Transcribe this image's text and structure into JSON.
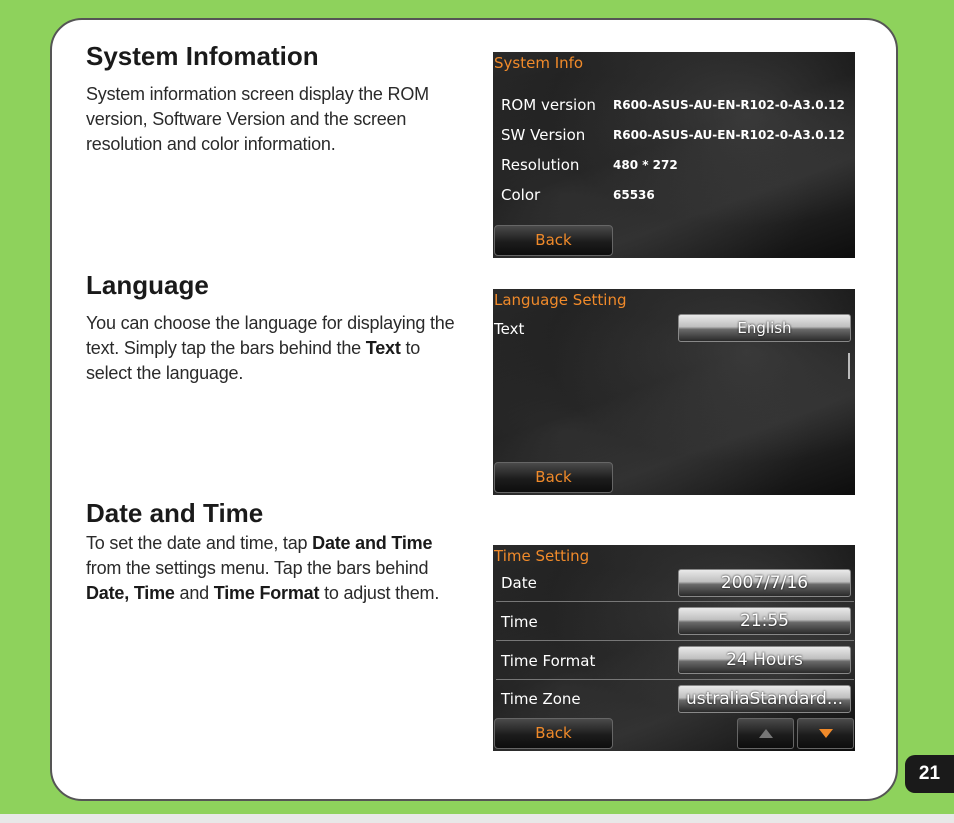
{
  "sections": {
    "system_info": {
      "heading": "System Infomation",
      "text": "System information screen display the ROM version, Software Version and the screen resolution and color information."
    },
    "language": {
      "heading": "Language",
      "text_before": "You can choose the language for displaying the text. Simply tap the bars behind the ",
      "text_bold": "Text",
      "text_after": " to select the language."
    },
    "date_time": {
      "heading": "Date and Time",
      "text_1": "To set the date and time, tap ",
      "bold_1": "Date and Time",
      "text_2": " from the settings menu. Tap the bars behind ",
      "bold_2": "Date, Time",
      "text_3": " and ",
      "bold_3": "Time Format",
      "text_4": " to adjust them."
    }
  },
  "screens": {
    "system_info": {
      "title": "System Info",
      "rows": [
        {
          "label": "ROM version",
          "value": "R600-ASUS-AU-EN-R102-0-A3.0.12"
        },
        {
          "label": "SW Version",
          "value": "R600-ASUS-AU-EN-R102-0-A3.0.12"
        },
        {
          "label": "Resolution",
          "value": "480 * 272"
        },
        {
          "label": "Color",
          "value": "65536"
        }
      ],
      "back_label": "Back"
    },
    "language": {
      "title": "Language Setting",
      "row_label": "Text",
      "row_value": "English",
      "back_label": "Back"
    },
    "time": {
      "title": "Time Setting",
      "rows": [
        {
          "label": "Date",
          "value": "2007/7/16"
        },
        {
          "label": "Time",
          "value": "21:55"
        },
        {
          "label": "Time Format",
          "value": "24 Hours"
        },
        {
          "label": "Time Zone",
          "value": "ustraliaStandard..."
        }
      ],
      "back_label": "Back"
    }
  },
  "page_number": "21",
  "colors": {
    "background": "#8ed25c",
    "accent_orange": "#f08a2a"
  }
}
